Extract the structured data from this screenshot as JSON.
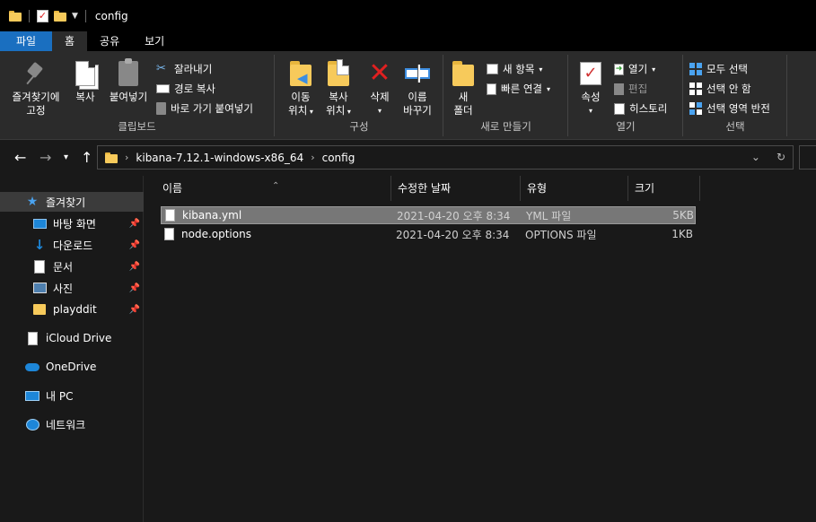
{
  "window": {
    "title": "config"
  },
  "tabs": [
    {
      "label": "파일"
    },
    {
      "label": "홈"
    },
    {
      "label": "공유"
    },
    {
      "label": "보기"
    }
  ],
  "ribbon": {
    "clipboard": {
      "pin_label_1": "즐겨찾기에",
      "pin_label_2": "고정",
      "copy": "복사",
      "paste": "붙여넣기",
      "cut": "잘라내기",
      "copy_path": "경로 복사",
      "paste_shortcut": "바로 가기 붙여넣기",
      "group": "클립보드"
    },
    "organize": {
      "move_1": "이동",
      "move_2": "위치",
      "copy_1": "복사",
      "copy_2": "위치",
      "delete": "삭제",
      "rename_1": "이름",
      "rename_2": "바꾸기",
      "group": "구성"
    },
    "new": {
      "new_folder_1": "새",
      "new_folder_2": "폴더",
      "new_item": "새 항목",
      "easy_access": "빠른 연결",
      "group": "새로 만들기"
    },
    "open": {
      "properties": "속성",
      "open": "열기",
      "edit": "편집",
      "history": "히스토리",
      "group": "열기"
    },
    "select": {
      "select_all": "모두 선택",
      "select_none": "선택 안 함",
      "invert": "선택 영역 반전",
      "group": "선택"
    }
  },
  "address": {
    "crumbs": [
      "kibana-7.12.1-windows-x86_64",
      "config"
    ]
  },
  "sidebar": {
    "items": [
      {
        "label": "즐겨찾기",
        "icon": "star-icon"
      },
      {
        "label": "바탕 화면",
        "icon": "desktop-icon"
      },
      {
        "label": "다운로드",
        "icon": "download-icon"
      },
      {
        "label": "문서",
        "icon": "documents-icon"
      },
      {
        "label": "사진",
        "icon": "pictures-icon"
      },
      {
        "label": "playddit",
        "icon": "folder-icon"
      },
      {
        "label": "iCloud Drive",
        "icon": "icloud-icon"
      },
      {
        "label": "OneDrive",
        "icon": "onedrive-icon"
      },
      {
        "label": "내 PC",
        "icon": "pc-icon"
      },
      {
        "label": "네트워크",
        "icon": "network-icon"
      }
    ]
  },
  "files": {
    "columns": [
      "이름",
      "수정한 날짜",
      "유형",
      "크기"
    ],
    "rows": [
      {
        "name": "kibana.yml",
        "modified": "2021-04-20 오후 8:34",
        "type": "YML 파일",
        "size": "5KB",
        "selected": true
      },
      {
        "name": "node.options",
        "modified": "2021-04-20 오후 8:34",
        "type": "OPTIONS 파일",
        "size": "1KB",
        "selected": false
      }
    ]
  },
  "colors": {
    "file_tab": "#1a6fc0",
    "accent": "#4aa3f0",
    "folder": "#f7ca5b"
  }
}
